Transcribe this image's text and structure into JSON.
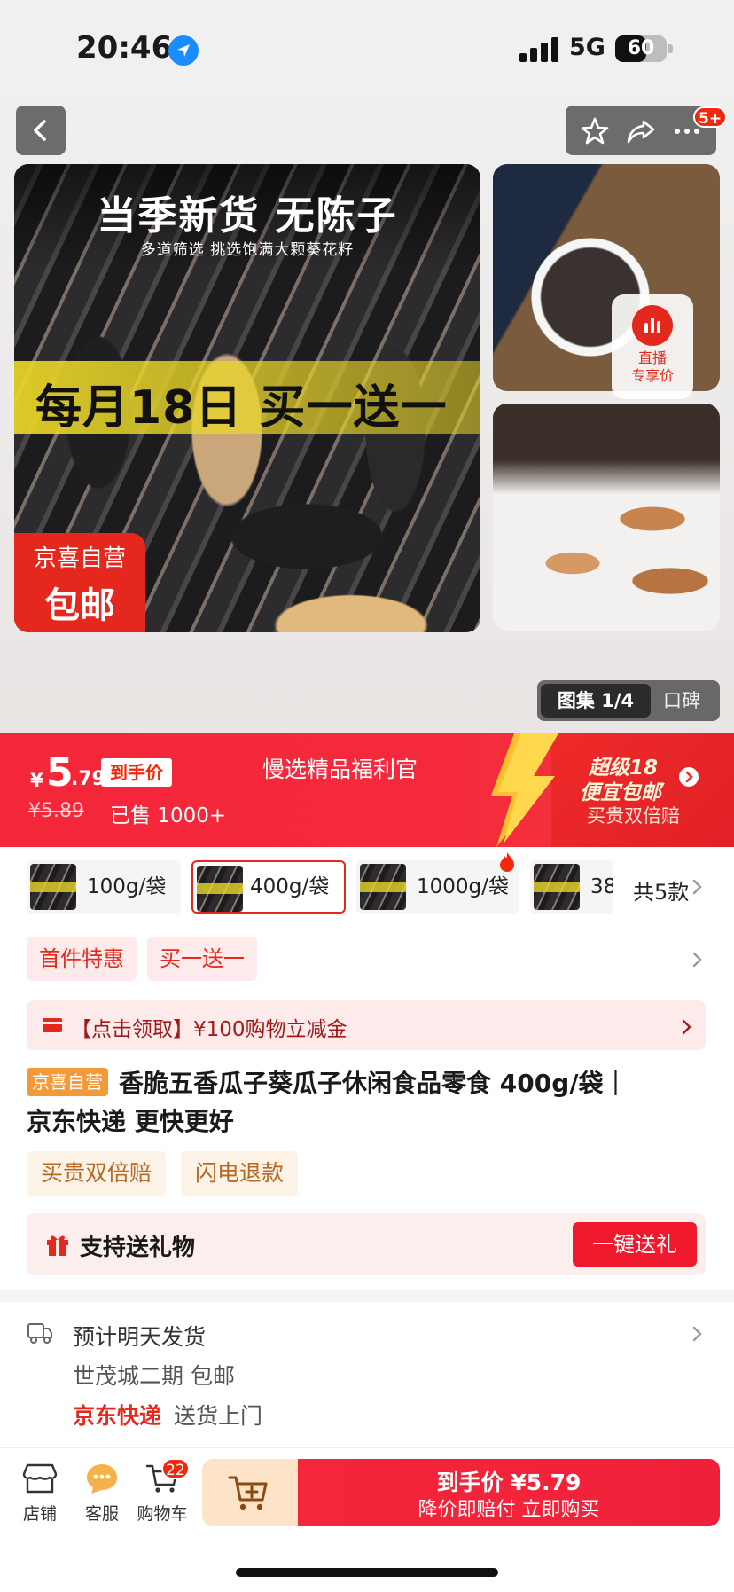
{
  "status_bar": {
    "time": "20:46",
    "network": "5G",
    "battery": "60",
    "battery_level": 0.6
  },
  "header": {
    "more_badge": "5+"
  },
  "gallery": {
    "headline": "当季新货 无陈子",
    "subline": "多道筛选 挑选饱满大颗葵花籽",
    "promo": "每月18日 买一送一",
    "tag_line1": "京喜自营",
    "tag_line2": "包邮",
    "live_line1": "直播",
    "live_line2": "专享价",
    "album_label": "图集 1/4",
    "review_label": "口碑"
  },
  "price_banner": {
    "currency": "¥",
    "price_int": "5",
    "price_dec": ".79",
    "final_tag": "到手价",
    "original_price": "¥5.89",
    "sold": "已售 1000+",
    "title": "慢选精品福利官",
    "right_line1": "超级18",
    "right_line2": "便宜包邮",
    "right_line3": "买贵双倍赔"
  },
  "variants": {
    "items": [
      {
        "label": "100g/袋",
        "selected": false
      },
      {
        "label": "400g/袋",
        "selected": true
      },
      {
        "label": "1000g/袋",
        "selected": false
      },
      {
        "label": "38",
        "selected": false
      }
    ],
    "total": "共5款"
  },
  "promo_tags": [
    "首件特惠",
    "买一送一"
  ],
  "coupon": {
    "text": "【点击领取】¥100购物立减金"
  },
  "product": {
    "shop_tag": "京喜自营",
    "title_line1": "香脆五香瓜子葵瓜子休闲食品零食 400g/袋｜",
    "title_line2": "京东快递 更快更好"
  },
  "service_tags": [
    "买贵双倍赔",
    "闪电退款"
  ],
  "gift": {
    "text": "支持送礼物",
    "button": "一键送礼"
  },
  "shipping": {
    "line1": "预计明天发货",
    "line2": "世茂城二期  包邮",
    "carrier": "京东快递",
    "delivery": "送货上门"
  },
  "bottom_bar": {
    "shop": "店铺",
    "service": "客服",
    "cart": "购物车",
    "cart_count": "22",
    "buy_line1": "到手价 ¥5.79",
    "buy_line2": "降价即赔付 立即购买"
  },
  "colors": {
    "brand_red": "#f2270c",
    "banner_red": "#f4263a",
    "tag_orange": "#f29a3a"
  }
}
